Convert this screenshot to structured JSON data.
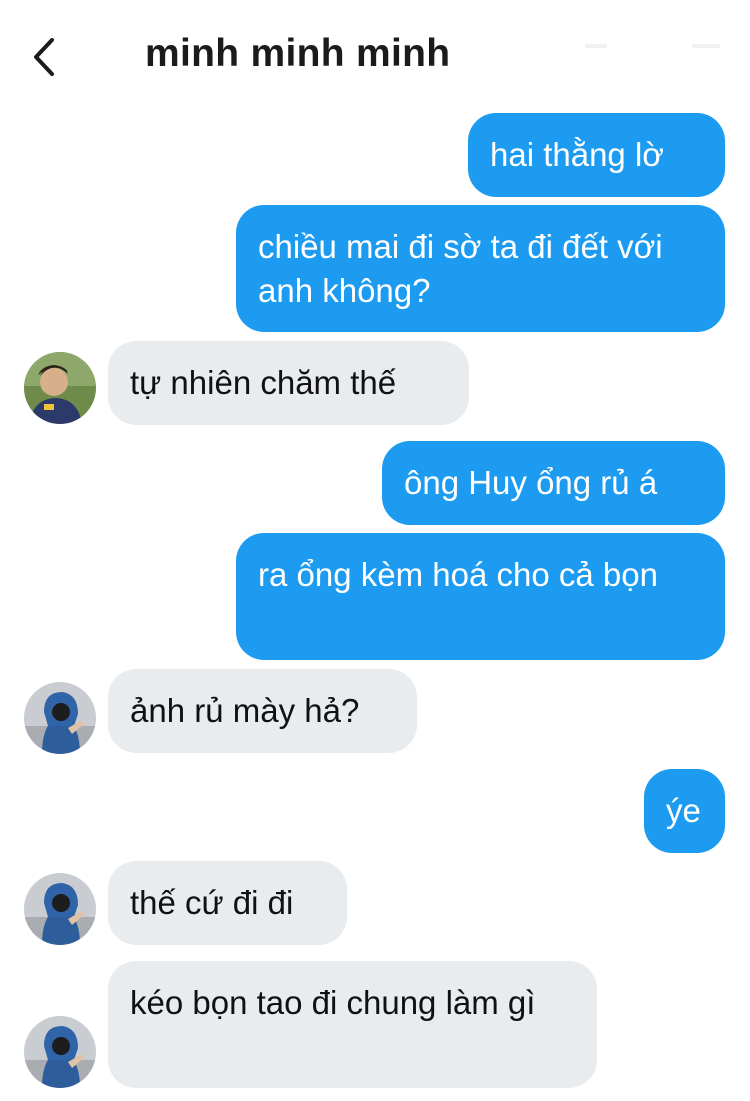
{
  "header": {
    "title": "minh minh minh",
    "back_icon": "chevron-left-icon"
  },
  "messages": [
    {
      "from": "me",
      "text": "hai thằng lờ"
    },
    {
      "from": "me",
      "text": "chiều mai đi sờ ta đi đết với anh không?"
    },
    {
      "from": "them",
      "text": "tự nhiên chăm thế"
    },
    {
      "from": "me",
      "text": "ông Huy ổng rủ á"
    },
    {
      "from": "me",
      "text": "ra ổng kèm hoá cho cả bọn"
    },
    {
      "from": "them",
      "text": "ảnh rủ mày hả?"
    },
    {
      "from": "me",
      "text": "ýe"
    },
    {
      "from": "them",
      "text": "thế cứ đi đi"
    },
    {
      "from": "them",
      "text": "kéo bọn tao đi chung làm gì"
    }
  ],
  "colors": {
    "outgoing_bubble": "#1d9bf0",
    "incoming_bubble": "#e9ecef",
    "outgoing_text": "#ffffff",
    "incoming_text": "#111111"
  }
}
